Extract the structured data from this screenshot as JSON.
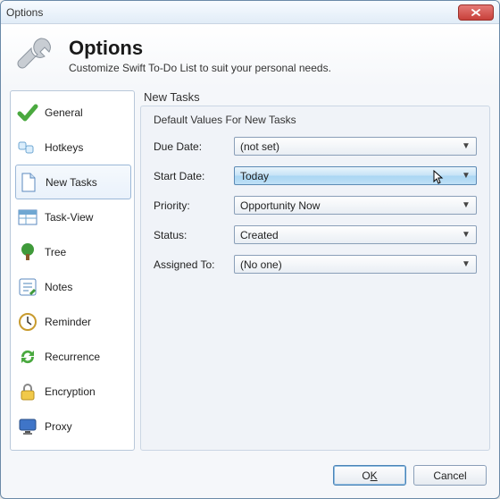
{
  "title": "Options",
  "header": {
    "title": "Options",
    "subtitle": "Customize Swift To-Do List to suit your personal needs."
  },
  "sidebar": {
    "items": [
      {
        "label": "General"
      },
      {
        "label": "Hotkeys"
      },
      {
        "label": "New Tasks"
      },
      {
        "label": "Task-View"
      },
      {
        "label": "Tree"
      },
      {
        "label": "Notes"
      },
      {
        "label": "Reminder"
      },
      {
        "label": "Recurrence"
      },
      {
        "label": "Encryption"
      },
      {
        "label": "Proxy"
      }
    ],
    "selected_index": 2
  },
  "main": {
    "section_title": "New Tasks",
    "group_title": "Default Values For New Tasks",
    "fields": {
      "due_date": {
        "label": "Due Date:",
        "value": "(not set)"
      },
      "start_date": {
        "label": "Start Date:",
        "value": "Today"
      },
      "priority": {
        "label": "Priority:",
        "value": "Opportunity Now"
      },
      "status": {
        "label": "Status:",
        "value": "Created"
      },
      "assigned_to": {
        "label": "Assigned To:",
        "value": "(No one)"
      }
    }
  },
  "footer": {
    "ok_prefix": "O",
    "ok_letter": "K",
    "cancel": "Cancel"
  }
}
